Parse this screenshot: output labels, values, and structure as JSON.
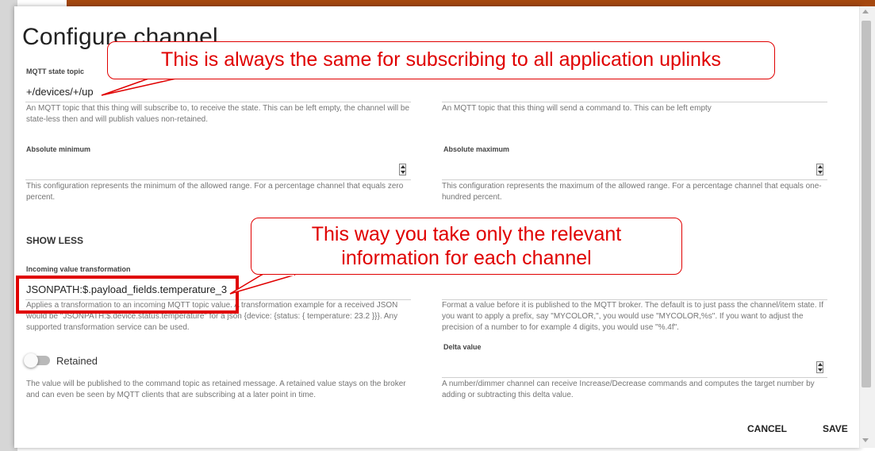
{
  "dialog": {
    "title": "Configure channel",
    "fields": {
      "mqtt_state_topic": {
        "label": "MQTT state topic",
        "value": "+/devices/+/up",
        "help": "An MQTT topic that this thing will subscribe to, to receive the state. This can be left empty, the channel will be state-less then and will publish values non-retained."
      },
      "mqtt_command_topic": {
        "label": "",
        "value": "",
        "help": "An MQTT topic that this thing will send a command to. This can be left empty"
      },
      "absolute_minimum": {
        "label": "Absolute minimum",
        "value": "",
        "help": "This configuration represents the minimum of the allowed range. For a percentage channel that equals zero percent."
      },
      "absolute_maximum": {
        "label": "Absolute maximum",
        "value": "",
        "help": "This configuration represents the maximum of the allowed range. For a percentage channel that equals one-hundred percent."
      },
      "show_less": "SHOW LESS",
      "incoming_transformation": {
        "label": "Incoming value transformation",
        "value": "JSONPATH:$.payload_fields.temperature_3",
        "help": "Applies a transformation to an incoming MQTT topic value. A transformation example for a received JSON would be \"JSONPATH:$.device.status.temperature\" for a json {device: {status: { temperature: 23.2 }}}. Any supported transformation service can be used."
      },
      "outgoing_format": {
        "label": "",
        "value": "",
        "help": "Format a value before it is published to the MQTT broker. The default is to just pass the channel/item state. If you want to apply a prefix, say \"MYCOLOR,\", you would use \"MYCOLOR,%s\". If you want to adjust the precision of a number to for example 4 digits, you would use \"%.4f\"."
      },
      "retained": {
        "label": "Retained",
        "checked": false,
        "help": "The value will be published to the command topic as retained message. A retained value stays on the broker and can even be seen by MQTT clients that are subscribing at a later point in time."
      },
      "delta_value": {
        "label": "Delta value",
        "value": "",
        "help": "A number/dimmer channel can receive Increase/Decrease commands and computes the target number by adding or subtracting this delta value."
      }
    },
    "buttons": {
      "cancel": "CANCEL",
      "save": "SAVE"
    }
  },
  "annotations": {
    "callout_1": "This is always the same for subscribing to all application uplinks",
    "callout_2_line1": "This way you take only the relevant",
    "callout_2_line2": "information for each channel"
  },
  "colors": {
    "accent": "#a5480f",
    "annotation": "#e00000"
  }
}
